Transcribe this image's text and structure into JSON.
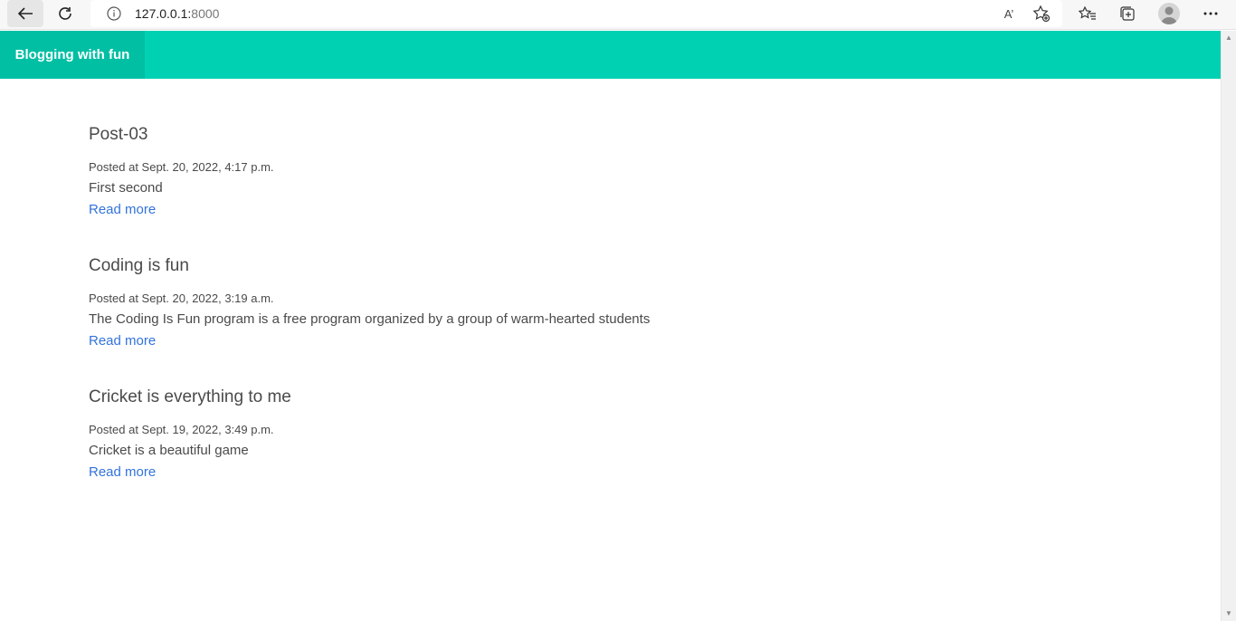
{
  "browser": {
    "url_host": "127.0.0.1:",
    "url_port": "8000",
    "icons": {
      "back": "arrow-left-icon",
      "reload": "reload-icon",
      "info": "info-icon",
      "read_aloud": "read-aloud-icon",
      "add_favorite": "star-add-icon",
      "favorites": "favorites-icon",
      "collections": "collections-icon",
      "profile": "profile-avatar-icon",
      "menu": "more-dots-icon"
    },
    "read_aloud_glyph": "A’"
  },
  "navbar": {
    "brand": "Blogging with fun",
    "color": "#00d1b2",
    "brand_bg": "#00bfa3"
  },
  "posts": [
    {
      "title": "Post-03",
      "date": "Posted at Sept. 20, 2022, 4:17 p.m.",
      "body": "First second",
      "link": "Read more"
    },
    {
      "title": "Coding is fun",
      "date": "Posted at Sept. 20, 2022, 3:19 a.m.",
      "body": "The Coding Is Fun program is a free program organized by a group of warm-hearted students",
      "link": "Read more"
    },
    {
      "title": "Cricket is everything to me",
      "date": "Posted at Sept. 19, 2022, 3:49 p.m.",
      "body": "Cricket is a beautiful game",
      "link": "Read more"
    }
  ],
  "colors": {
    "link": "#3273dc",
    "text": "#4a4a4a"
  }
}
